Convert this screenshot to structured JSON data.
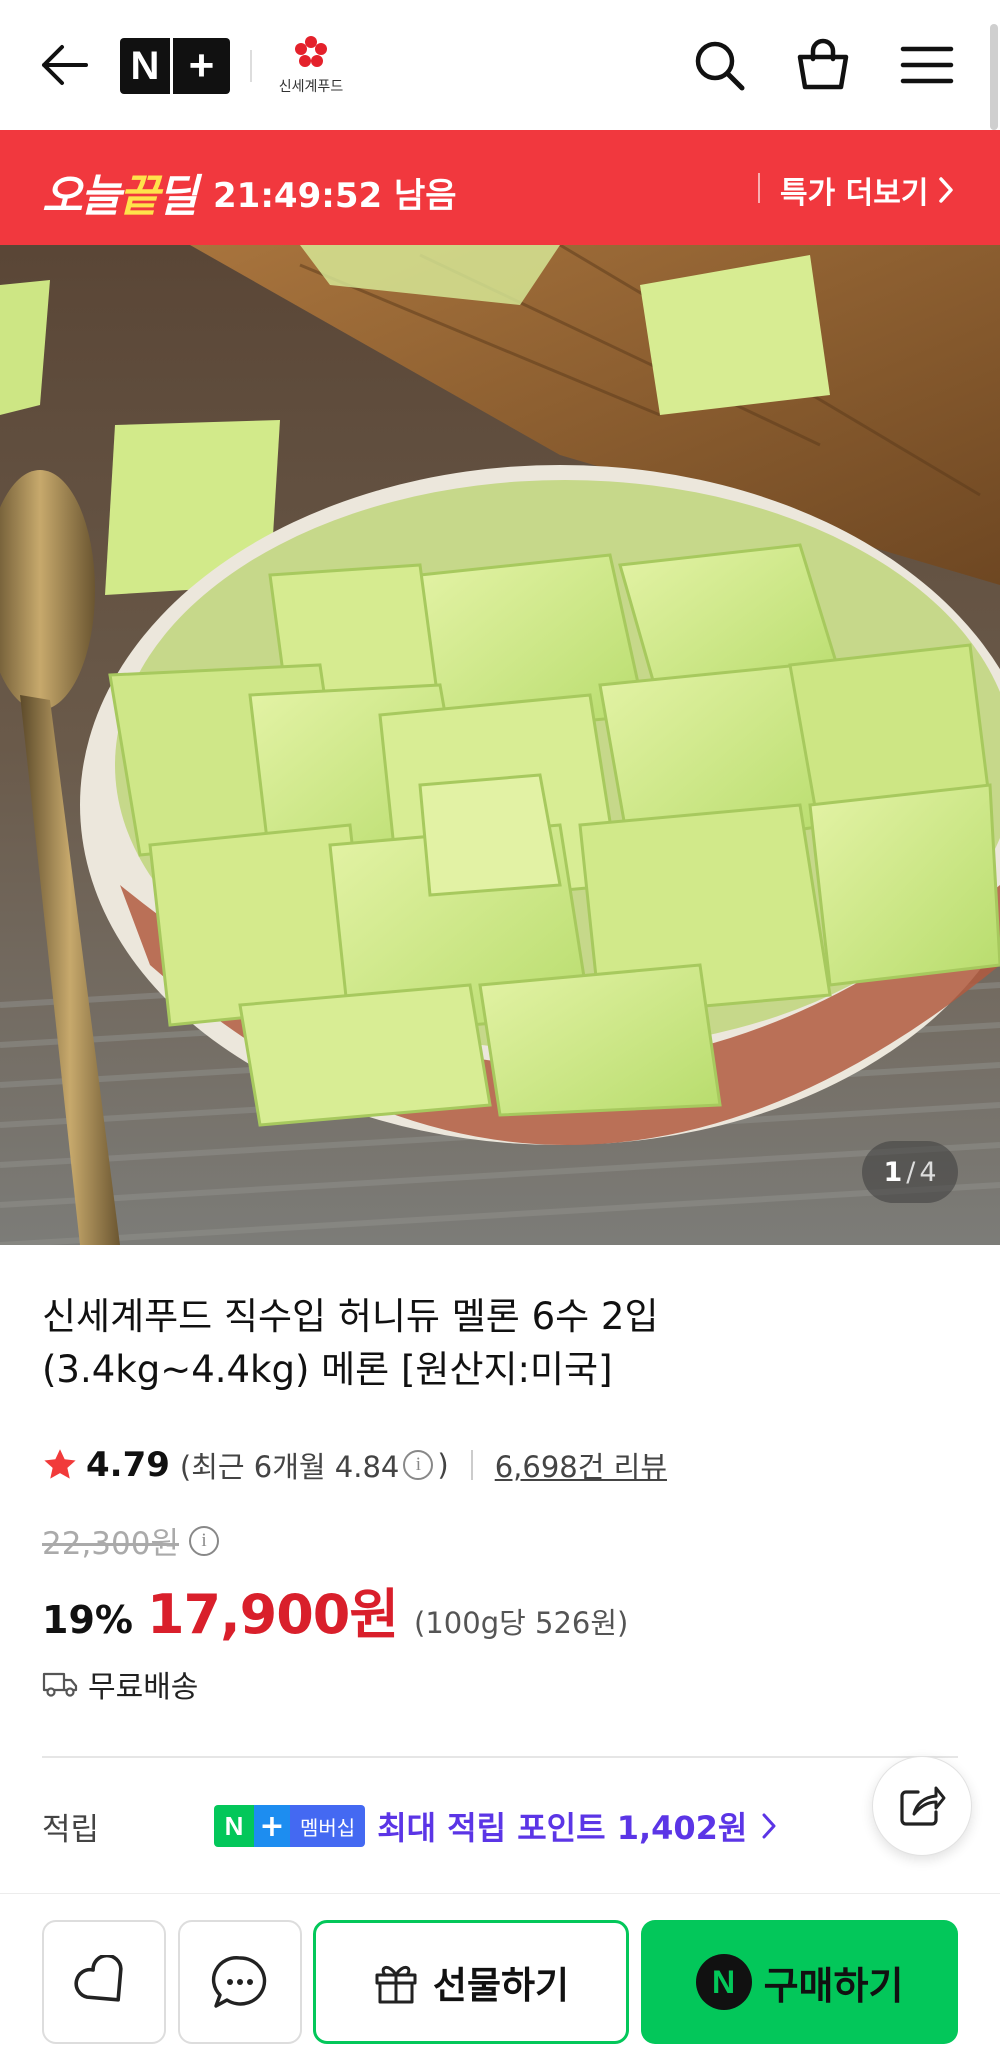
{
  "header": {
    "logo_n": "N",
    "logo_plus": "+",
    "brand_name": "신세계푸드"
  },
  "deal": {
    "logo_a": "오늘",
    "logo_b": "끝",
    "logo_c": "딜",
    "timer": "21:49:52 남음",
    "more_label": "특가 더보기"
  },
  "gallery": {
    "current": "1",
    "separator": "/",
    "total": "4"
  },
  "product": {
    "title": "신세계푸드 직수입 허니듀 멜론 6수 2입 (3.4kg~4.4kg) 메론 [원산지:미국]",
    "rating": "4.79",
    "recent_rating": "(최근 6개월 4.84",
    "recent_close": ")",
    "info_glyph": "i",
    "review_count": "6,698건 리뷰",
    "original_price": "22,300원",
    "discount": "19%",
    "price": "17,900원",
    "unit_price": "(100g당 526원)",
    "shipping": "무료배송"
  },
  "points": {
    "label": "적립",
    "badge_n": "N",
    "badge_plus": "+",
    "badge_text": "멤버십",
    "text": "최대 적립 포인트 1,402원"
  },
  "bottom": {
    "gift_label": "선물하기",
    "buy_n": "N",
    "buy_label": "구매하기"
  },
  "colors": {
    "deal_red": "#f1383e",
    "price_red": "#d91f2b",
    "naver_green": "#03c75a",
    "membership_purple": "#5b35e6"
  },
  "icons": [
    "back-arrow-icon",
    "search-icon",
    "shopping-bag-icon",
    "hamburger-menu-icon",
    "chevron-right-icon",
    "star-icon",
    "info-icon",
    "delivery-truck-icon",
    "share-icon",
    "heart-icon",
    "chat-bubble-icon",
    "gift-icon"
  ]
}
